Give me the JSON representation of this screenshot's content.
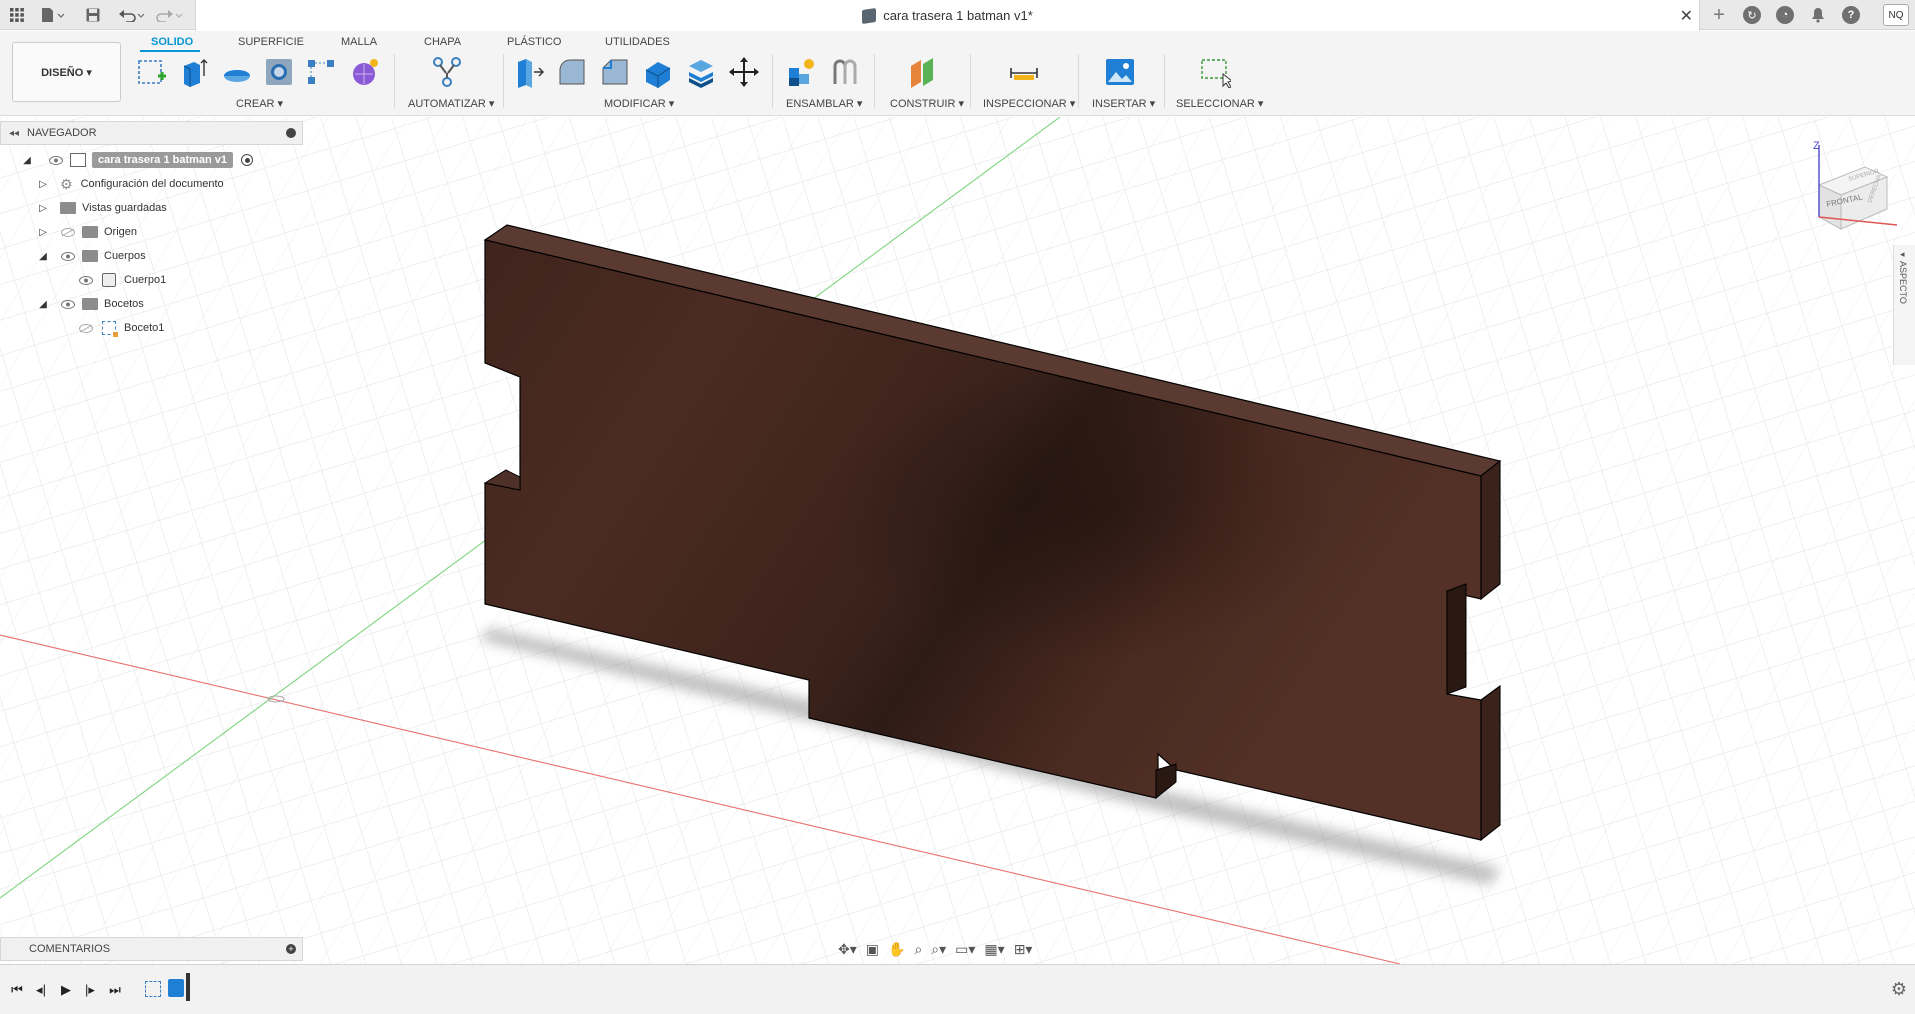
{
  "window": {
    "document_title": "cara trasera 1 batman v1*",
    "user_initials": "NQ"
  },
  "ribbon": {
    "workspace": "DISEÑO ▾",
    "tabs": [
      "SOLIDO",
      "SUPERFICIE",
      "MALLA",
      "CHAPA",
      "PLÁSTICO",
      "UTILIDADES"
    ],
    "active_tab": "SOLIDO",
    "groups": {
      "crear": "CREAR ▾",
      "automatizar": "AUTOMATIZAR ▾",
      "modificar": "MODIFICAR ▾",
      "ensamblar": "ENSAMBLAR ▾",
      "construir": "CONSTRUIR ▾",
      "inspeccionar": "INSPECCIONAR ▾",
      "insertar": "INSERTAR ▾",
      "seleccionar": "SELECCIONAR ▾"
    }
  },
  "navigator": {
    "title": "NAVEGADOR",
    "root": "cara trasera 1 batman v1",
    "items": [
      {
        "label": "Configuración del documento",
        "icon": "gear-icon"
      },
      {
        "label": "Vistas guardadas",
        "icon": "folder-icon"
      },
      {
        "label": "Origen",
        "icon": "folder-icon"
      },
      {
        "label": "Cuerpos",
        "icon": "folder-icon"
      },
      {
        "label": "Cuerpo1",
        "icon": "body-icon"
      },
      {
        "label": "Bocetos",
        "icon": "folder-icon"
      },
      {
        "label": "Boceto1",
        "icon": "sketch-icon"
      }
    ]
  },
  "viewcube": {
    "axis_z": "Z",
    "face_front": "FRONTAL",
    "face_top": "SUPERIOR",
    "face_right": "DERECHA"
  },
  "side_panel": {
    "label": "ASPECTO"
  },
  "comments": {
    "title": "COMENTARIOS"
  },
  "colors": {
    "accent": "#0696d7",
    "wood": "#4a2b21",
    "wood_dark": "#2c1712",
    "axis_x": "#e87070",
    "axis_y": "#7ed57e"
  }
}
